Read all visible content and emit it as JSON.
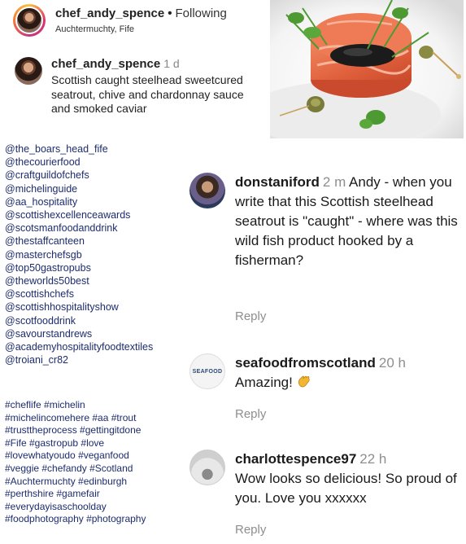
{
  "post": {
    "username": "chef_andy_spence",
    "separator": "•",
    "follow_status": "Following",
    "location": "Auchtermuchty, Fife"
  },
  "caption": {
    "username": "chef_andy_spence",
    "time": "1 d",
    "text": "Scottish caught steelhead sweetcured seatrout, chive and chardonnay sauce and smoked caviar",
    "mentions": [
      "@the_boars_head_fife",
      "@thecourierfood",
      "@craftguildofchefs",
      "@michelinguide",
      "@aa_hospitality",
      "@scottishexcellenceawards",
      "@scotsmanfoodanddrink",
      "@thestaffcanteen",
      "@masterchefsgb",
      "@top50gastropubs",
      "@theworlds50best",
      "@scottishchefs",
      "@scottishhospitalityshow",
      "@scotfooddrink",
      "@savourstandrews",
      "@academyhospitalityfoodtextiles",
      "@troiani_cr82"
    ],
    "hashtags": [
      "#cheflife #michelin",
      "#michelincomehere #aa #trout",
      "#trusttheprocess #gettingitdone",
      "#Fife #gastropub #love",
      "#lovewhatyoudo #veganfood",
      "#veggie #chefandy #Scotland",
      "#Auchtermuchty #edinburgh",
      "#perthshire #gamefair",
      "#everydayisaschoolday",
      "#foodphotography #photography"
    ]
  },
  "comments": [
    {
      "username": "donstaniford",
      "time": "2 m",
      "text": "Andy - when you write that this Scottish steelhead seatrout is \"caught\" - where was this wild fish product hooked by a fisherman?",
      "reply": "Reply"
    },
    {
      "username": "seafoodfromscotland",
      "time": "20 h",
      "text": "Amazing!",
      "emoji": "clapping-hands",
      "avatar_text": "SEAFOOD",
      "reply": "Reply"
    },
    {
      "username": "charlottespence97",
      "time": "22 h",
      "text": "Wow looks so delicious! So proud of you. Love you xxxxxx",
      "reply": "Reply"
    }
  ],
  "colors": {
    "link": "#1c2c6e",
    "muted": "#8e8e8e",
    "salmon": "#e2714d",
    "herb": "#4e9a32"
  }
}
